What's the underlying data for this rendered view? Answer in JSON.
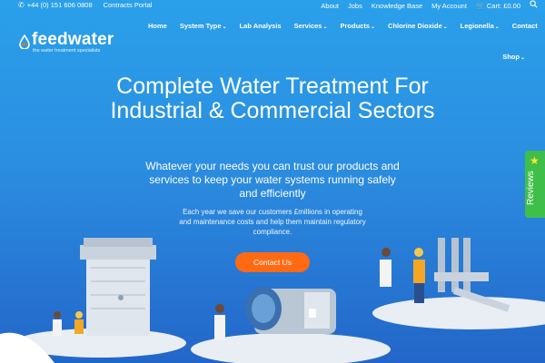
{
  "topbar": {
    "phone": "+44 (0) 151 606 0808",
    "contracts": "Contracts Portal",
    "links": [
      "About",
      "Jobs",
      "Knowledge Base",
      "My Account"
    ],
    "cart": "Cart: £0.00"
  },
  "brand": {
    "name": "feedwater",
    "tagline": "the water treatment specialists"
  },
  "nav": {
    "items": [
      {
        "label": "Home",
        "chevron": false
      },
      {
        "label": "System Type",
        "chevron": true
      },
      {
        "label": "Lab Analysis",
        "chevron": false
      },
      {
        "label": "Services",
        "chevron": true
      },
      {
        "label": "Products",
        "chevron": true
      },
      {
        "label": "Chlorine Dioxide",
        "chevron": true
      },
      {
        "label": "Legionella",
        "chevron": true
      },
      {
        "label": "Contact",
        "chevron": false
      }
    ],
    "shop": "Shop"
  },
  "hero": {
    "headline": "Complete Water Treatment For Industrial & Commercial Sectors",
    "subheading": "Whatever your needs you can trust our products and services to keep your water systems running safely and efficiently",
    "body": "Each year we save our customers £millions in operating and maintenance costs and help them maintain regulatory compliance.",
    "cta": "Contact Us"
  },
  "reviews": {
    "label": "Reviews"
  },
  "colors": {
    "accent": "#ff6a13",
    "reviews_green": "#3fbf4a",
    "bg_top": "#2aa0ea",
    "bg_bottom": "#2366c9"
  },
  "icons": [
    "phone-icon",
    "cart-icon",
    "search-icon",
    "water-drop-icon",
    "star-icon",
    "chevron-down-icon"
  ]
}
